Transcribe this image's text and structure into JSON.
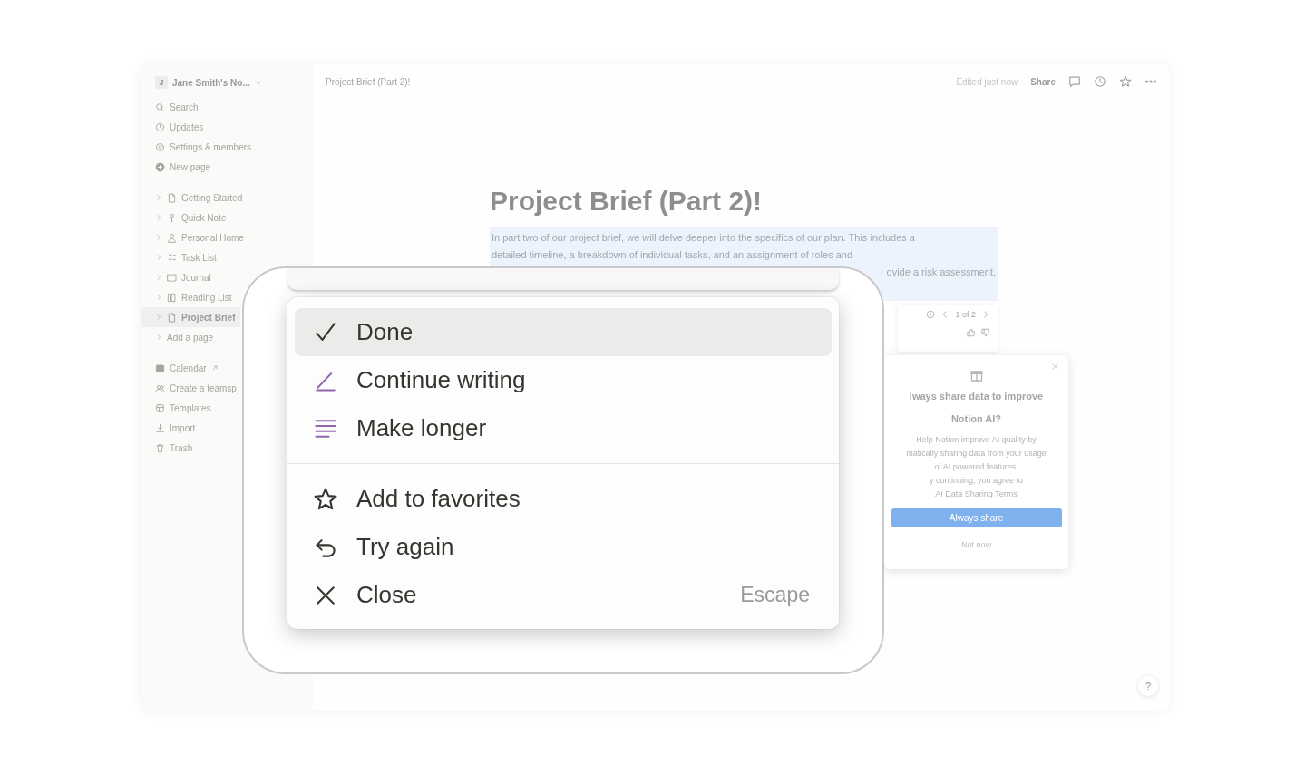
{
  "sidebar": {
    "workspace": {
      "initial": "J",
      "name": "Jane Smith's No..."
    },
    "top_items": [
      {
        "label": "Search"
      },
      {
        "label": "Updates"
      },
      {
        "label": "Settings & members"
      },
      {
        "label": "New page"
      }
    ],
    "pages": [
      {
        "label": "Getting Started",
        "selected": false
      },
      {
        "label": "Quick Note",
        "selected": false
      },
      {
        "label": "Personal Home",
        "selected": false
      },
      {
        "label": "Task List",
        "selected": false
      },
      {
        "label": "Journal",
        "selected": false
      },
      {
        "label": "Reading List",
        "selected": false
      },
      {
        "label": "Project Brief",
        "selected": true
      }
    ],
    "add_page": "Add a page",
    "bottom_items": [
      {
        "label": "Calendar"
      },
      {
        "label": "Create a teamsp"
      },
      {
        "label": "Templates"
      },
      {
        "label": "Import"
      },
      {
        "label": "Trash"
      }
    ]
  },
  "topbar": {
    "breadcrumb": "Project Brief (Part 2)!",
    "status": "Edited just now",
    "share": "Share"
  },
  "page": {
    "title": "Project Brief (Part 2)!",
    "paragraph_lines": [
      "In part two of our project brief, we will delve deeper into the specifics of our plan. This includes a",
      "detailed timeline, a breakdown of individual tasks, and an assignment of roles and",
      "ovide a risk assessment,"
    ],
    "pager": "1 of 2"
  },
  "popup": {
    "title_lines": [
      "lways share data to improve",
      "Notion AI?"
    ],
    "body_lines": [
      "Help Notion improve AI quality by",
      "matically sharing data from your usage",
      "of AI powered features."
    ],
    "consent": "y continuing, you agree to",
    "consent_link": "AI Data Sharing Terms",
    "primary": "Always share",
    "secondary": "Not now"
  },
  "help": "?",
  "menu": {
    "sections": [
      {
        "items": [
          {
            "label": "Done",
            "color": "#37352f",
            "selected": true
          },
          {
            "label": "Continue writing",
            "color": "#9065b0",
            "selected": false
          },
          {
            "label": "Make longer",
            "color": "#9065b0",
            "selected": false
          }
        ]
      },
      {
        "items": [
          {
            "label": "Add to favorites",
            "color": "#37352f",
            "selected": false
          },
          {
            "label": "Try again",
            "color": "#37352f",
            "selected": false
          },
          {
            "label": "Close",
            "color": "#37352f",
            "selected": false,
            "shortcut": "Escape"
          }
        ]
      }
    ]
  }
}
